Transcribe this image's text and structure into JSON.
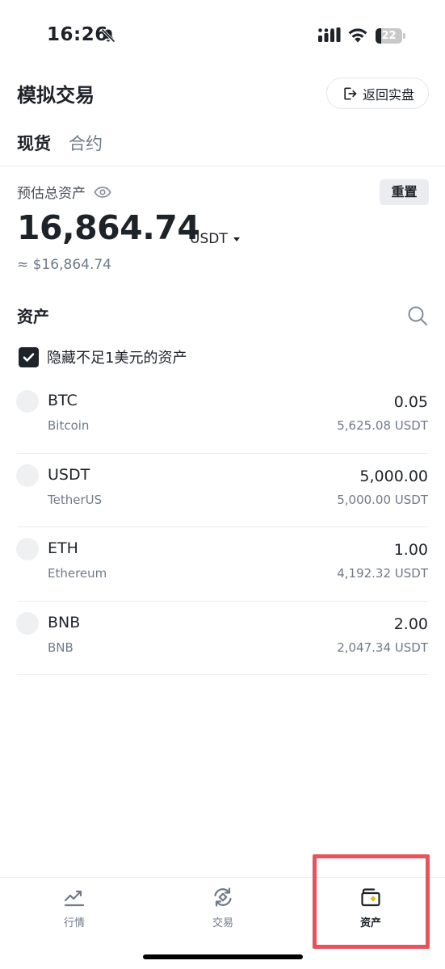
{
  "status_bar": {
    "time": "16:26",
    "battery_level": "22",
    "battery_fraction": 0.22,
    "icons": [
      "bell-slash-icon",
      "signal-icon",
      "wifi-icon",
      "battery-icon"
    ]
  },
  "header": {
    "title": "模拟交易",
    "back_button_label": "返回实盘",
    "back_button_icon": "exit-icon"
  },
  "tabs": [
    {
      "label": "现货",
      "active": true
    },
    {
      "label": "合约",
      "active": false
    }
  ],
  "balance": {
    "label": "预估总资产",
    "eye_icon": "eye-icon",
    "reset_label": "重置",
    "value": "16,864.74",
    "currency": "USDT",
    "approx": "≈ $16,864.74"
  },
  "assets": {
    "title": "资产",
    "hide_small_label": "隐藏不足1美元的资产",
    "hide_small_checked": true,
    "items": [
      {
        "symbol": "BTC",
        "name": "Bitcoin",
        "amount": "0.05",
        "value": "5,625.08 USDT"
      },
      {
        "symbol": "USDT",
        "name": "TetherUS",
        "amount": "5,000.00",
        "value": "5,000.00 USDT"
      },
      {
        "symbol": "ETH",
        "name": "Ethereum",
        "amount": "1.00",
        "value": "4,192.32 USDT"
      },
      {
        "symbol": "BNB",
        "name": "BNB",
        "amount": "2.00",
        "value": "2,047.34 USDT"
      }
    ]
  },
  "bottom_nav": {
    "items": [
      {
        "label": "行情",
        "icon": "chart-trend-icon",
        "active": false
      },
      {
        "label": "交易",
        "icon": "trade-swap-icon",
        "active": false
      },
      {
        "label": "资产",
        "icon": "wallet-icon",
        "active": true
      }
    ]
  },
  "colors": {
    "text_primary": "#1e2329",
    "text_secondary": "#707a8a",
    "accent_yellow": "#f0b90b",
    "highlight_red": "#e8535a"
  }
}
